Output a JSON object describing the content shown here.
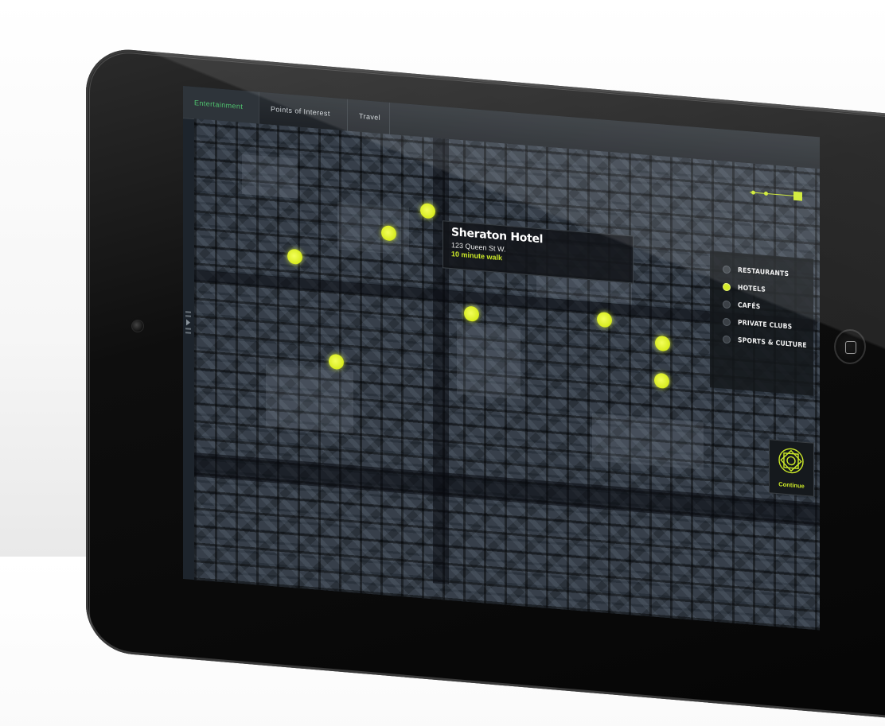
{
  "tabs": [
    {
      "label": "Entertainment",
      "active": true
    },
    {
      "label": "Points of Interest",
      "active": false
    },
    {
      "label": "Travel",
      "active": false
    }
  ],
  "info_card": {
    "name": "Sheraton Hotel",
    "address": "123 Queen St W.",
    "walk_time": "10 minute walk"
  },
  "filters": [
    {
      "label": "RESTAURANTS",
      "selected": false
    },
    {
      "label": "HOTELS",
      "selected": true
    },
    {
      "label": "CAFÉS",
      "selected": false
    },
    {
      "label": "PRIVATE CLUBS",
      "selected": false
    },
    {
      "label": "SPORTS & CULTURE",
      "selected": false
    }
  ],
  "continue_button": {
    "label": "Continue",
    "icon": "ornament-star-icon"
  },
  "map": {
    "marker_count": 9,
    "marker_color": "#d9ec22",
    "accent_color": "#cdea28",
    "active_tab_color": "#4fc36f"
  }
}
